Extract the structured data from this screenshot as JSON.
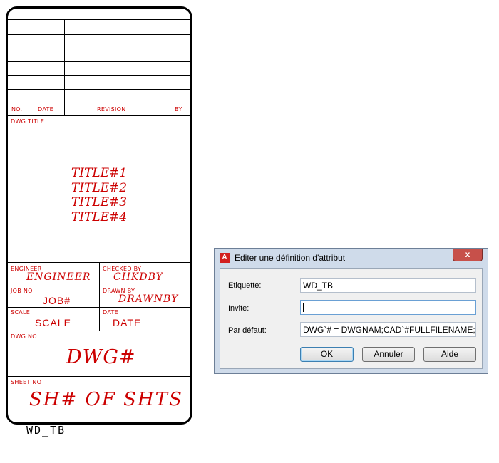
{
  "title_block": {
    "name": "WD_TB",
    "revision_header": {
      "no": "NO.",
      "date": "DATE",
      "revision": "REVISION",
      "by": "BY"
    },
    "dwg_title_label": "DWG TITLE",
    "titles": [
      "TITLE#1",
      "TITLE#2",
      "TITLE#3",
      "TITLE#4"
    ],
    "engineer_label": "ENGINEER",
    "engineer_value": "ENGINEER",
    "checked_by_label": "CHECKED BY",
    "checked_by_value": "CHKDBY",
    "job_no_label": "JOB NO",
    "job_no_value": "JOB#",
    "drawn_by_label": "DRAWN BY",
    "drawn_by_value": "DRAWNBY",
    "scale_label": "SCALE",
    "scale_value": "SCALE",
    "date_label": "DATE",
    "date_value": "DATE",
    "dwg_no_label": "DWG NO",
    "dwg_no_value": "DWG#",
    "sheet_no_label": "SHEET NO",
    "sheet_no_value": "SH# OF SHTS",
    "text_color": "#cc0000"
  },
  "dialog": {
    "title": "Editer une définition d'attribut",
    "close_glyph": "x",
    "fields": {
      "etiquette_label": "Etiquette:",
      "etiquette_value": "WD_TB",
      "invite_label": "Invite:",
      "invite_value": "",
      "defaut_label": "Par défaut:",
      "defaut_value": "DWG`# = DWGNAM;CAD`#FULLFILENAME;SH"
    },
    "buttons": {
      "ok": "OK",
      "cancel": "Annuler",
      "help": "Aide"
    }
  }
}
